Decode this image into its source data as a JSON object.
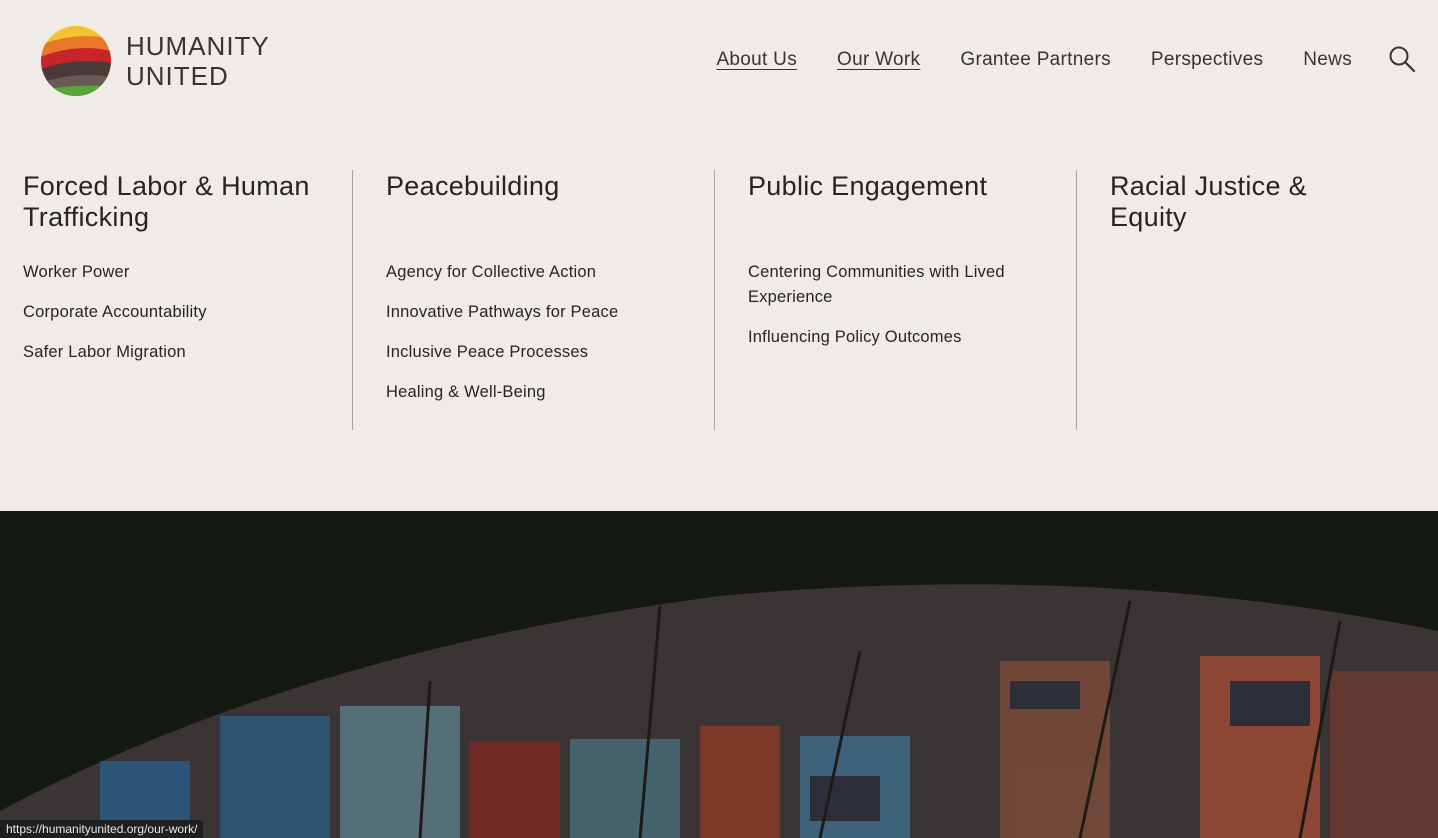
{
  "brand": {
    "line1": "HUMANITY",
    "line2": "UNITED"
  },
  "nav": {
    "items": [
      "About Us",
      "Our Work",
      "Grantee Partners",
      "Perspectives",
      "News"
    ]
  },
  "icons": {
    "search": "search-icon",
    "logo": "sphere-logo-icon"
  },
  "mega_menu": {
    "columns": [
      {
        "title": "Forced Labor & Human Trafficking",
        "links": [
          "Worker Power",
          "Corporate Accountability",
          "Safer Labor Migration"
        ]
      },
      {
        "title": "Peacebuilding",
        "links": [
          "Agency for Collective Action",
          "Innovative Pathways for Peace",
          "Inclusive Peace Processes",
          "Healing & Well-Being"
        ]
      },
      {
        "title": "Public Engagement",
        "links": [
          "Centering Communities with Lived Experience",
          "Influencing Policy Outcomes"
        ]
      },
      {
        "title": "Racial Justice & Equity",
        "links": []
      }
    ]
  },
  "status_bar": {
    "url": "https://humanityunited.org/our-work/"
  },
  "colors": {
    "background": "#f0ebe6",
    "text": "#2a2320",
    "hero_bg": "#141a12"
  }
}
